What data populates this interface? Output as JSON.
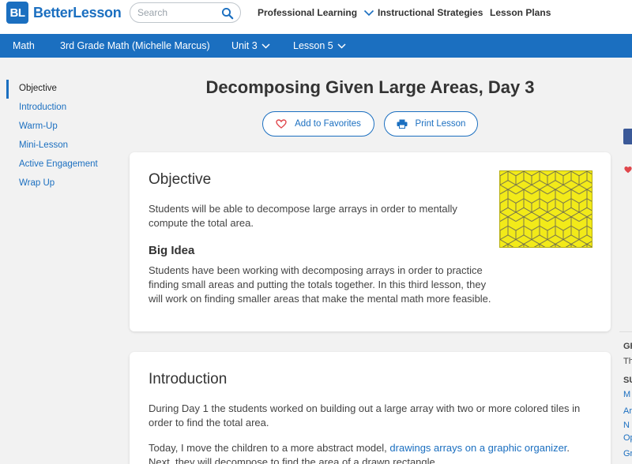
{
  "brand": {
    "badge": "BL",
    "name": "BetterLesson"
  },
  "search": {
    "placeholder": "Search"
  },
  "nav": {
    "professional_learning": "Professional Learning",
    "instructional_strategies": "Instructional Strategies",
    "lesson_plans": "Lesson Plans"
  },
  "breadcrumb": {
    "subject": "Math",
    "course": "3rd Grade Math (Michelle Marcus)",
    "unit": "Unit 3",
    "lesson": "Lesson 5"
  },
  "sidebar": {
    "items": [
      {
        "label": "Objective"
      },
      {
        "label": "Introduction"
      },
      {
        "label": "Warm-Up"
      },
      {
        "label": "Mini-Lesson"
      },
      {
        "label": "Active Engagement"
      },
      {
        "label": "Wrap Up"
      }
    ]
  },
  "lesson": {
    "title": "Decomposing Given Large Areas, Day 3",
    "favorite_label": "Add to Favorites",
    "print_label": "Print Lesson"
  },
  "objective": {
    "heading": "Objective",
    "text": "Students will be able to decompose large arrays in order to mentally compute the total area.",
    "big_idea_heading": "Big Idea",
    "big_idea_text": "Students have been working with decomposing arrays in order to practice finding small areas and putting the totals together. In this third lesson, they will work on finding smaller areas that make the mental math more feasible."
  },
  "introduction": {
    "heading": "Introduction",
    "para1": "During Day 1 the students worked on building out a large array with two or more colored tiles in order to find the total area.",
    "para2_before": "Today, I move the children to a more abstract model, ",
    "para2_link": "drawings arrays on a graphic organizer",
    "para2_after": ". Next, they will decompose to find the area of a drawn rectangle."
  },
  "rail": {
    "r1": "GR",
    "r2": "Th",
    "r3": "SU",
    "r4": "M",
    "r5": "Ar",
    "r6": "N",
    "r7": "Op",
    "r8": "Gr"
  },
  "colors": {
    "brand_blue": "#1b6fc0",
    "thumb_yellow": "#f2ea19",
    "favorite_red": "#e0474c"
  }
}
